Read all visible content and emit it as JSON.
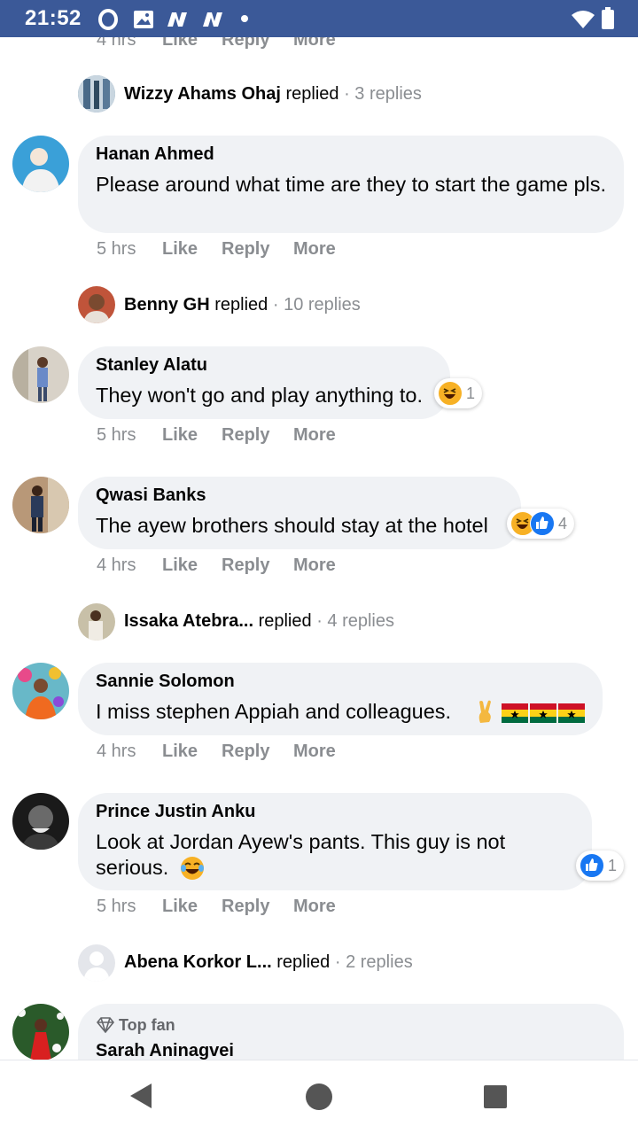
{
  "status_bar": {
    "time": "21:52"
  },
  "partial_top_actions": {
    "time": "4 hrs",
    "like": "Like",
    "reply": "Reply",
    "more": "More"
  },
  "threads": [
    {
      "author": "Wizzy Ahams Ohaj",
      "verb": "replied",
      "count": "· 3 replies"
    },
    {
      "author": "Benny GH",
      "verb": "replied",
      "count": "· 10 replies"
    },
    {
      "author": "Issaka Atebra...",
      "verb": "replied",
      "count": "· 4 replies"
    },
    {
      "author": "Abena Korkor L...",
      "verb": "replied",
      "count": "· 2 replies"
    }
  ],
  "comments": [
    {
      "author": "Hanan Ahmed",
      "text": "Please around what time are they to start the game pls.",
      "time": "5 hrs",
      "like": "Like",
      "reply": "Reply",
      "more": "More"
    },
    {
      "author": "Stanley Alatu",
      "text": "They won't go and play anything to.",
      "time": "5 hrs",
      "like": "Like",
      "reply": "Reply",
      "more": "More",
      "reaction_count": "1"
    },
    {
      "author": "Qwasi Banks",
      "text": "The ayew brothers should stay at the hotel",
      "time": "4 hrs",
      "like": "Like",
      "reply": "Reply",
      "more": "More",
      "reaction_count": "4"
    },
    {
      "author": "Sannie Solomon",
      "text": "I miss stephen Appiah and colleagues.",
      "time": "4 hrs",
      "like": "Like",
      "reply": "Reply",
      "more": "More"
    },
    {
      "author": "Prince Justin Anku",
      "text": "Look at Jordan Ayew's pants. This guy is not serious.",
      "time": "5 hrs",
      "like": "Like",
      "reply": "Reply",
      "more": "More",
      "reaction_count": "1"
    },
    {
      "author": "Sarah Aninagvei",
      "badge": "Top fan"
    }
  ],
  "colors": {
    "status_bar": "#3b5998",
    "bubble": "#f0f2f5",
    "muted": "#8a8d91",
    "like_blue": "#1877f2",
    "haha_yellow": "#f7b125"
  }
}
